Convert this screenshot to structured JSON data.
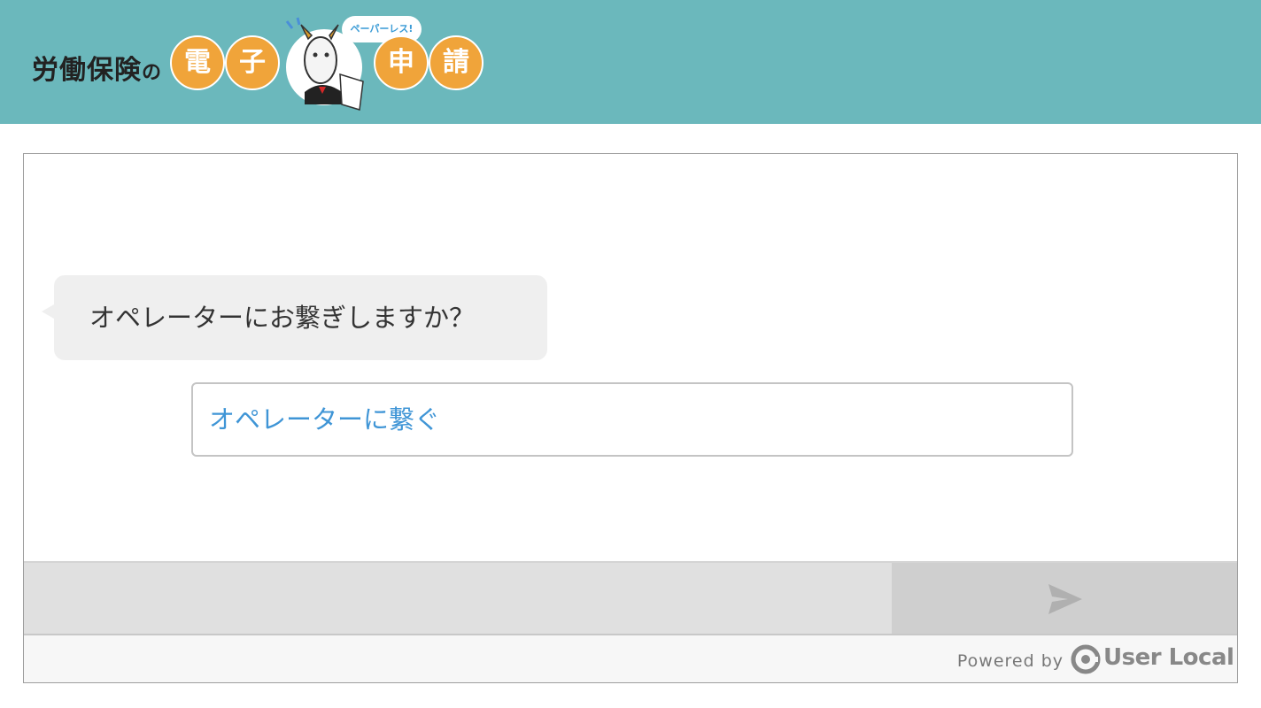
{
  "header": {
    "logo_text": "労働保険",
    "logo_particle": "の",
    "circle_chars": [
      "電",
      "子",
      "申",
      "請"
    ],
    "speech_tag": "ペーパーレス!",
    "colors": {
      "background": "#6bb8bc",
      "circle": "#f0a43a"
    }
  },
  "chat": {
    "bot_message": "オペレーターにお繋ぎしますか？",
    "choice_label": "オペレーターに繋ぐ",
    "input_value": "",
    "send_icon": "paper-plane-icon"
  },
  "footer": {
    "powered_by": "Powered by",
    "brand": "User Local"
  }
}
